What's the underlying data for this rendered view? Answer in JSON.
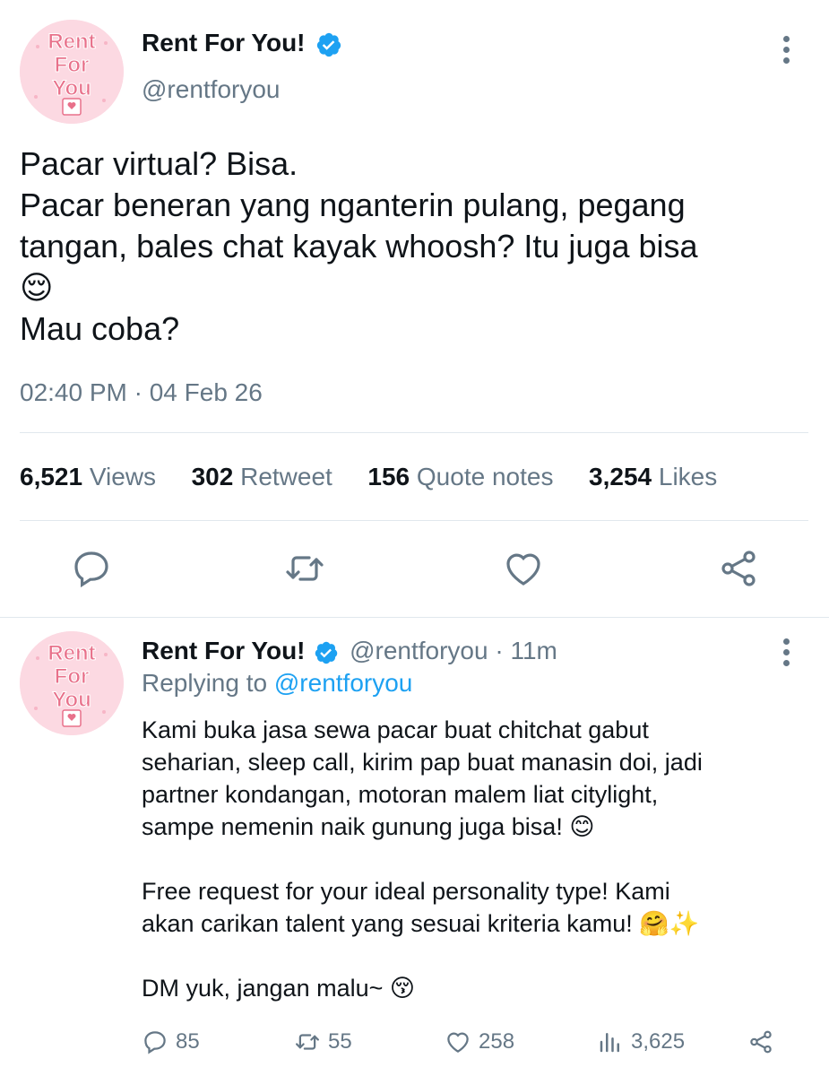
{
  "main_tweet": {
    "author_name": "Rent For You!",
    "author_handle": "@rentforyou",
    "avatar_text": [
      "Rent",
      "For",
      "You"
    ],
    "text_lines": [
      "Pacar virtual? Bisa.",
      "Pacar beneran yang nganterin pulang, pegang",
      "tangan, bales chat kayak whoosh? Itu juga bisa",
      "😌",
      "Mau coba?"
    ],
    "timestamp": "02:40 PM · 04 Feb 26",
    "stats": [
      {
        "count": "6,521",
        "label": "Views"
      },
      {
        "count": "302",
        "label": "Retweet"
      },
      {
        "count": "156",
        "label": "Quote notes"
      },
      {
        "count": "3,254",
        "label": "Likes"
      }
    ],
    "actions": [
      "reply-icon",
      "retweet-icon",
      "like-icon",
      "share-icon"
    ]
  },
  "reply_tweet": {
    "author_name": "Rent For You!",
    "author_handle": "@rentforyou",
    "time_ago": "· 11m",
    "replying_label": "Replying to",
    "replying_handle": "@rentforyou",
    "avatar_text": [
      "Rent",
      "For",
      "You"
    ],
    "paragraph1": [
      "Kami buka jasa sewa pacar buat chitchat gabut",
      "seharian, sleep call, kirim pap buat manasin doi, jadi",
      "partner kondangan, motoran malem liat citylight,",
      "sampe nemenin naik gunung juga bisa! 😊"
    ],
    "paragraph2": [
      "Free request for your ideal personality type! Kami",
      "akan carikan talent yang sesuai kriteria kamu! 🤗✨"
    ],
    "paragraph3": [
      "DM yuk, jangan malu~ 😚"
    ],
    "counts": {
      "replies": "85",
      "retweets": "55",
      "likes": "258",
      "views": "3,625"
    }
  },
  "colors": {
    "accent": "#1da1f2",
    "secondary_text": "#657786",
    "divider": "#e1e8ed",
    "avatar_bg": "#fcd9e2",
    "avatar_text": "#e8708a"
  }
}
